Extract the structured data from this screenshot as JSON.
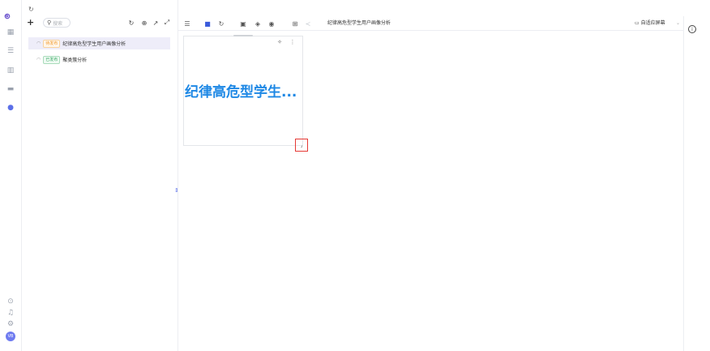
{
  "rail": {
    "logo": "ၜ",
    "icons": [
      "grid-icon",
      "database-icon",
      "chart-icon",
      "folder-icon",
      "dashboard-icon"
    ],
    "bottom_icons": [
      "help-icon",
      "bell-icon",
      "settings-icon"
    ],
    "avatar": "VB"
  },
  "tree": {
    "search_placeholder": "搜索",
    "items": [
      {
        "status": "待发布",
        "label": "纪律高危型学生用户画像分析"
      },
      {
        "status": "已发布",
        "label": "聚类簇分析"
      }
    ]
  },
  "editor": {
    "title": "纪律高危型学生用户画像分析",
    "screen_mode": "自适应屏幕"
  },
  "widget": {
    "text": "纪律高危型学生..."
  },
  "colors": {
    "accent": "#5b6fe8",
    "widget_text": "#1e88e5",
    "draft_badge": "#f29a2e",
    "published_badge": "#3bab66",
    "highlight_border": "#e53935"
  }
}
